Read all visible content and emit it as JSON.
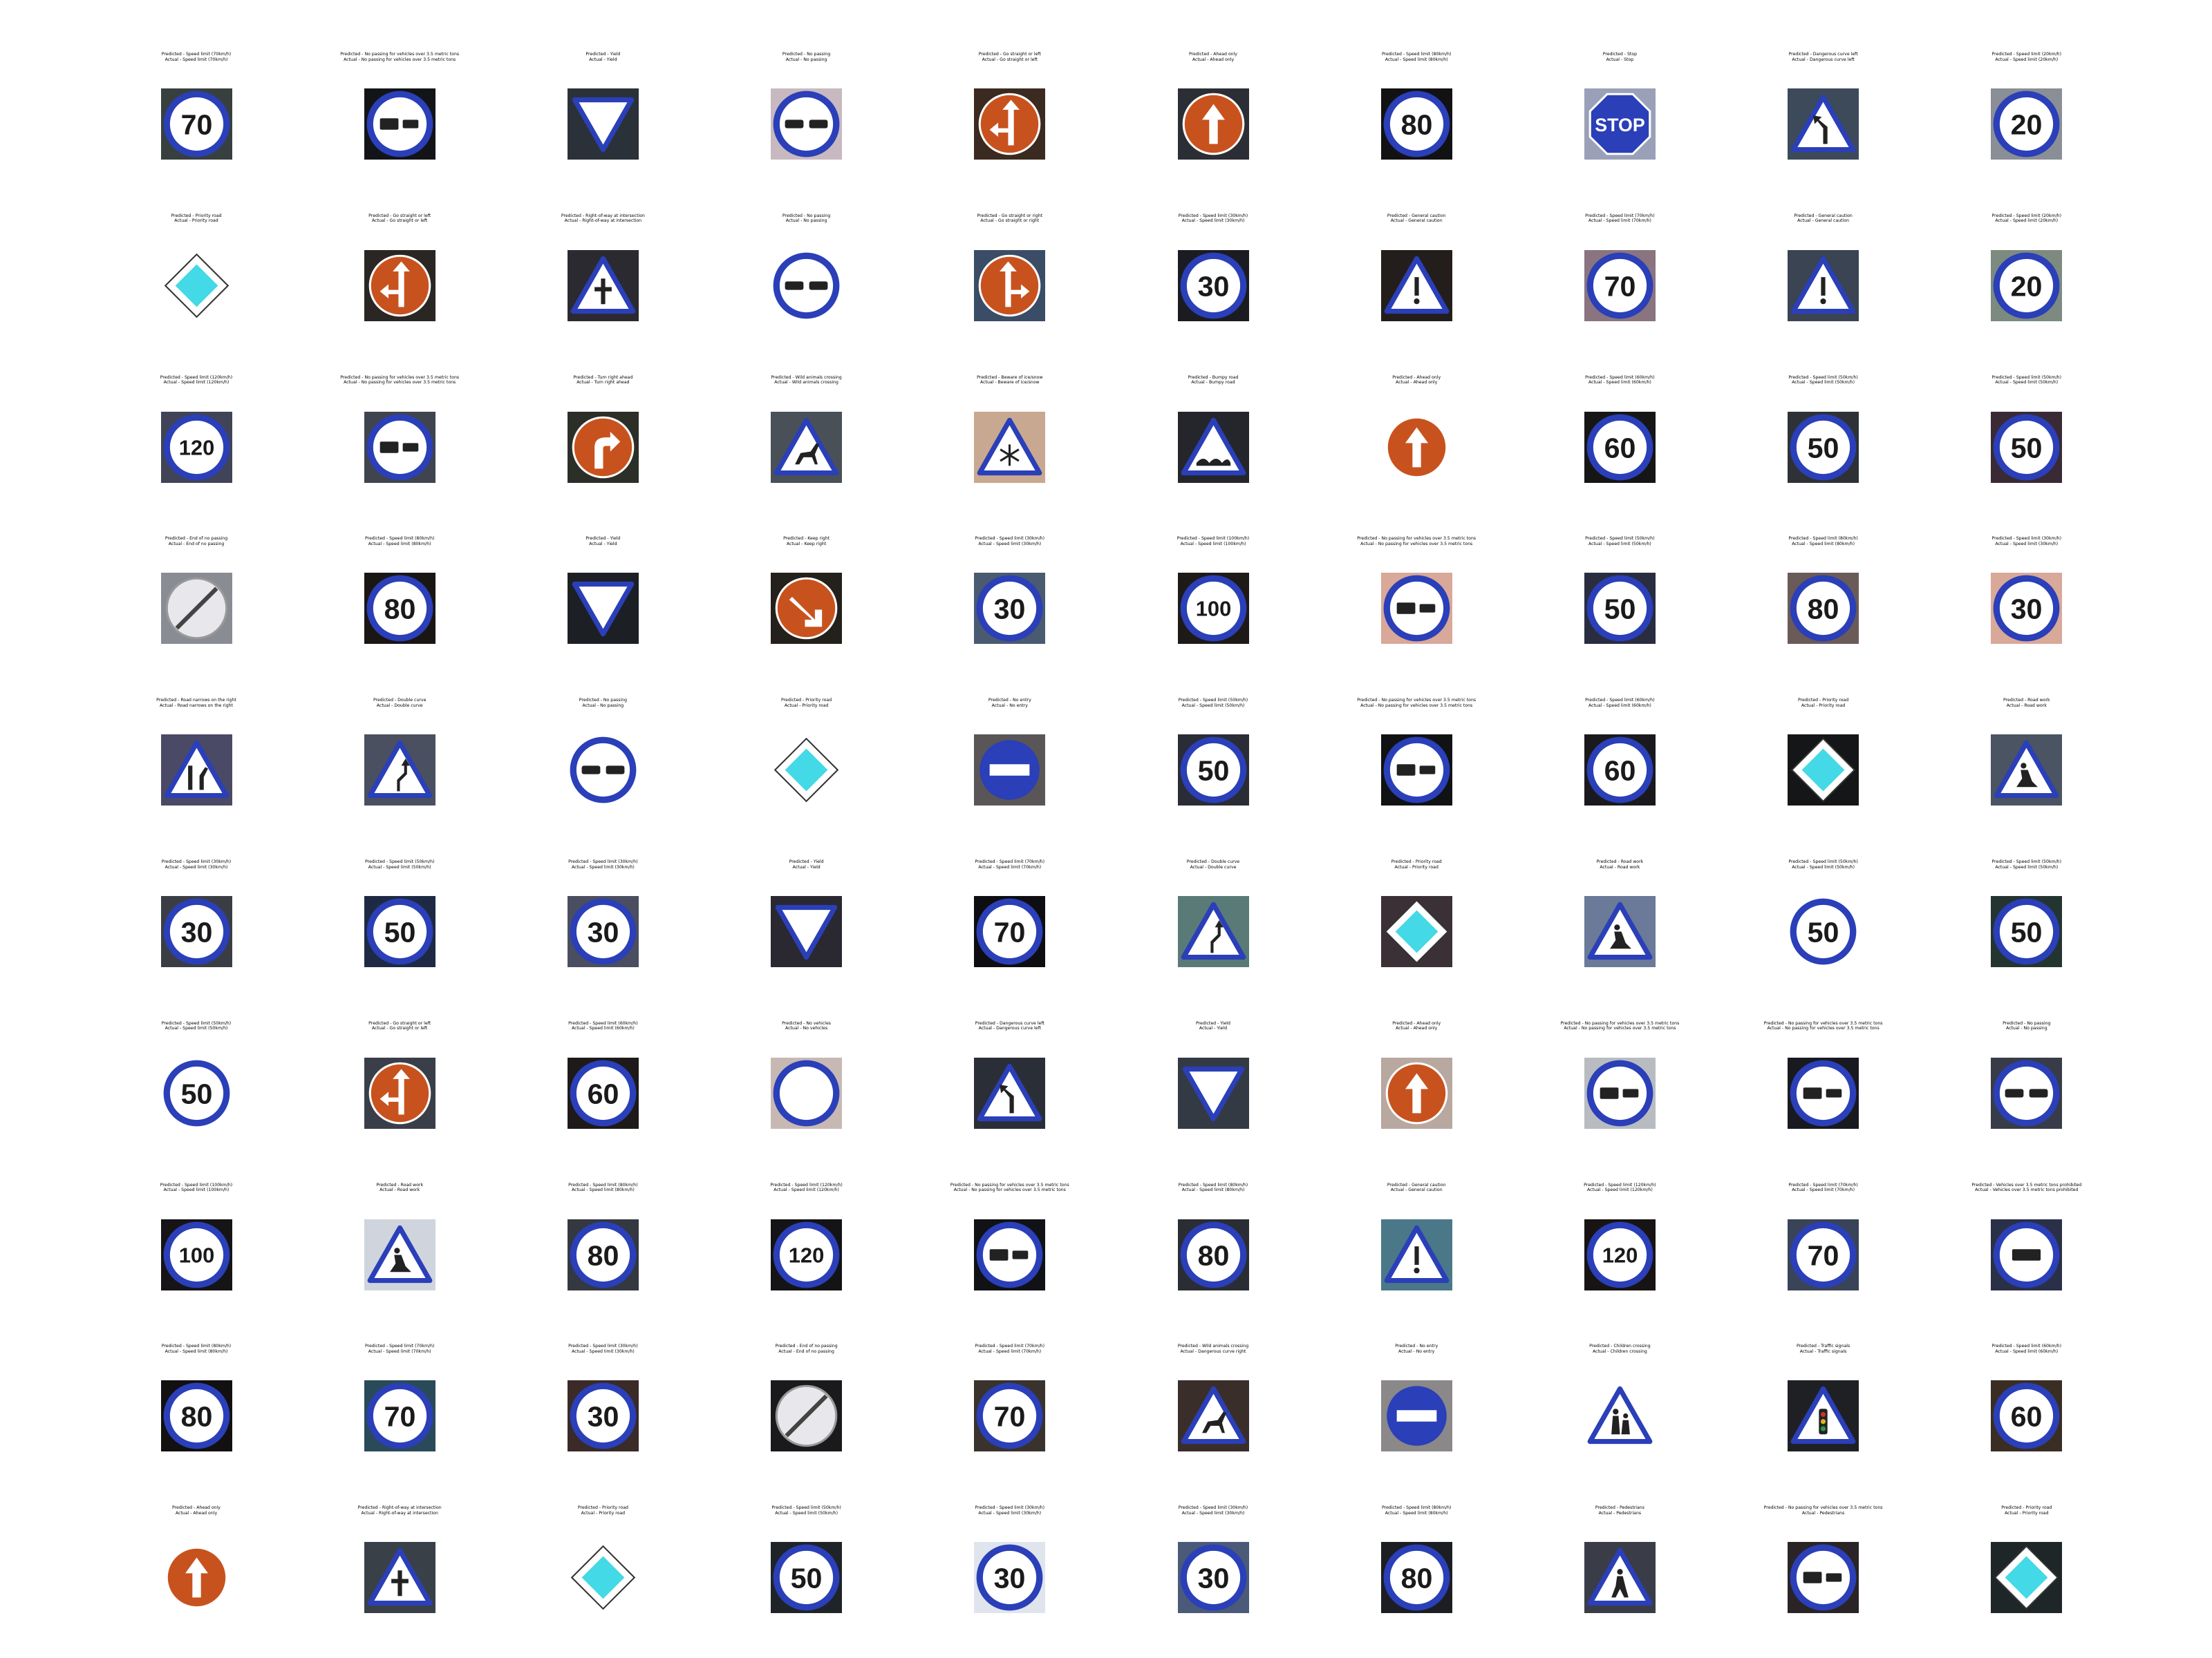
{
  "caption_prefixes": {
    "predicted": "Predicted - ",
    "actual": "Actual - "
  },
  "colors": {
    "blue": "#2a3fb8",
    "red": "#c0392b",
    "orange": "#c8521e",
    "white": "#ffffff",
    "yellow_diamond": "#44d9e6"
  },
  "grid": [
    [
      {
        "predicted": "Speed limit (70km/h)",
        "actual": "Speed limit (70km/h)",
        "icon": "speed-limit-sign",
        "text": "70",
        "bg": "#37403f"
      },
      {
        "predicted": "No passing for vehicles over 3.5 metric tons",
        "actual": "No passing for vehicles over 3.5 metric tons",
        "icon": "no-passing-trucks-sign",
        "text": "",
        "bg": "#131418"
      },
      {
        "predicted": "Yield",
        "actual": "Yield",
        "icon": "yield-sign",
        "text": "",
        "bg": "#2b3138"
      },
      {
        "predicted": "No passing",
        "actual": "No passing",
        "icon": "no-passing-sign",
        "text": "",
        "bg": "#c8b8c0"
      },
      {
        "predicted": "Go straight or left",
        "actual": "Go straight or left",
        "icon": "go-straight-or-left-sign",
        "text": "",
        "bg": "#3b2a20"
      },
      {
        "predicted": "Ahead only",
        "actual": "Ahead only",
        "icon": "ahead-only-sign",
        "text": "",
        "bg": "#2b2e34"
      },
      {
        "predicted": "Speed limit (80km/h)",
        "actual": "Speed limit (80km/h)",
        "icon": "speed-limit-sign",
        "text": "80",
        "bg": "#121214"
      },
      {
        "predicted": "Stop",
        "actual": "Stop",
        "icon": "stop-sign",
        "text": "STOP",
        "bg": "#9aa0b8"
      },
      {
        "predicted": "Dangerous curve left",
        "actual": "Dangerous curve left",
        "icon": "dangerous-curve-sign",
        "text": "",
        "bg": "#3c4a5a"
      },
      {
        "predicted": "Speed limit (20km/h)",
        "actual": "Speed limit (20km/h)",
        "icon": "speed-limit-sign",
        "text": "20",
        "bg": "#8a8e96"
      }
    ],
    [
      {
        "predicted": "Priority road",
        "actual": "Priority road",
        "icon": "priority-road-sign",
        "text": "",
        "bg": "#ffffff"
      },
      {
        "predicted": "Go straight or left",
        "actual": "Go straight or left",
        "icon": "go-straight-or-left-sign",
        "text": "",
        "bg": "#2a2624"
      },
      {
        "predicted": "Right-of-way at intersection",
        "actual": "Right-of-way at intersection",
        "icon": "right-of-way-sign",
        "text": "",
        "bg": "#2a2a30"
      },
      {
        "predicted": "No passing",
        "actual": "No passing",
        "icon": "no-passing-sign",
        "text": "",
        "bg": "#ffffff"
      },
      {
        "predicted": "Go straight or right",
        "actual": "Go straight or right",
        "icon": "go-straight-or-right-sign",
        "text": "",
        "bg": "#3a4c66"
      },
      {
        "predicted": "Speed limit (30km/h)",
        "actual": "Speed limit (30km/h)",
        "icon": "speed-limit-sign",
        "text": "30",
        "bg": "#1a1c22"
      },
      {
        "predicted": "General caution",
        "actual": "General caution",
        "icon": "general-caution-sign",
        "text": "",
        "bg": "#231e1c"
      },
      {
        "predicted": "Speed limit (70km/h)",
        "actual": "Speed limit (70km/h)",
        "icon": "speed-limit-sign",
        "text": "70",
        "bg": "#8a7480"
      },
      {
        "predicted": "General caution",
        "actual": "General caution",
        "icon": "general-caution-sign",
        "text": "",
        "bg": "#3a4452"
      },
      {
        "predicted": "Speed limit (20km/h)",
        "actual": "Speed limit (20km/h)",
        "icon": "speed-limit-sign",
        "text": "20",
        "bg": "#7c8a80"
      }
    ],
    [
      {
        "predicted": "Speed limit (120km/h)",
        "actual": "Speed limit (120km/h)",
        "icon": "speed-limit-sign",
        "text": "120",
        "bg": "#404456"
      },
      {
        "predicted": "No passing for vehicles over 3.5 metric tons",
        "actual": "No passing for vehicles over 3.5 metric tons",
        "icon": "no-passing-trucks-sign",
        "text": "",
        "bg": "#40444e"
      },
      {
        "predicted": "Turn right ahead",
        "actual": "Turn right ahead",
        "icon": "turn-right-ahead-sign",
        "text": "",
        "bg": "#2c2e28"
      },
      {
        "predicted": "Wild animals crossing",
        "actual": "Wild animals crossing",
        "icon": "wild-animals-sign",
        "text": "",
        "bg": "#4a5058"
      },
      {
        "predicted": "Beware of ice/snow",
        "actual": "Beware of ice/snow",
        "icon": "ice-snow-sign",
        "text": "",
        "bg": "#c8a890"
      },
      {
        "predicted": "Bumpy road",
        "actual": "Bumpy road",
        "icon": "bumpy-road-sign",
        "text": "",
        "bg": "#24262c"
      },
      {
        "predicted": "Ahead only",
        "actual": "Ahead only",
        "icon": "ahead-only-sign",
        "text": "",
        "bg": "#ffffff"
      },
      {
        "predicted": "Speed limit (60km/h)",
        "actual": "Speed limit (60km/h)",
        "icon": "speed-limit-sign",
        "text": "60",
        "bg": "#161616"
      },
      {
        "predicted": "Speed limit (50km/h)",
        "actual": "Speed limit (50km/h)",
        "icon": "speed-limit-sign",
        "text": "50",
        "bg": "#2e3236"
      },
      {
        "predicted": "Speed limit (50km/h)",
        "actual": "Speed limit (50km/h)",
        "icon": "speed-limit-sign",
        "text": "50",
        "bg": "#3a2a36"
      }
    ],
    [
      {
        "predicted": "End of no passing",
        "actual": "End of no passing",
        "icon": "end-of-no-passing-sign",
        "text": "",
        "bg": "#8a8c94"
      },
      {
        "predicted": "Speed limit (80km/h)",
        "actual": "Speed limit (80km/h)",
        "icon": "speed-limit-sign",
        "text": "80",
        "bg": "#1a1614"
      },
      {
        "predicted": "Yield",
        "actual": "Yield",
        "icon": "yield-sign",
        "text": "",
        "bg": "#1c2024"
      },
      {
        "predicted": "Keep right",
        "actual": "Keep right",
        "icon": "keep-right-sign",
        "text": "",
        "bg": "#24201c"
      },
      {
        "predicted": "Speed limit (30km/h)",
        "actual": "Speed limit (30km/h)",
        "icon": "speed-limit-sign",
        "text": "30",
        "bg": "#4a5a70"
      },
      {
        "predicted": "Speed limit (100km/h)",
        "actual": "Speed limit (100km/h)",
        "icon": "speed-limit-sign",
        "text": "100",
        "bg": "#1e1a18"
      },
      {
        "predicted": "No passing for vehicles over 3.5 metric tons",
        "actual": "No passing for vehicles over 3.5 metric tons",
        "icon": "no-passing-trucks-sign",
        "text": "",
        "bg": "#d8a898"
      },
      {
        "predicted": "Speed limit (50km/h)",
        "actual": "Speed limit (50km/h)",
        "icon": "speed-limit-sign",
        "text": "50",
        "bg": "#2a2c40"
      },
      {
        "predicted": "Speed limit (80km/h)",
        "actual": "Speed limit (80km/h)",
        "icon": "speed-limit-sign",
        "text": "80",
        "bg": "#6a5a58"
      },
      {
        "predicted": "Speed limit (30km/h)",
        "actual": "Speed limit (30km/h)",
        "icon": "speed-limit-sign",
        "text": "30",
        "bg": "#d8a898"
      }
    ],
    [
      {
        "predicted": "Road narrows on the right",
        "actual": "Road narrows on the right",
        "icon": "road-narrows-sign",
        "text": "",
        "bg": "#4a4a66"
      },
      {
        "predicted": "Double curve",
        "actual": "Double curve",
        "icon": "double-curve-sign",
        "text": "",
        "bg": "#4a5060"
      },
      {
        "predicted": "No passing",
        "actual": "No passing",
        "icon": "no-passing-sign",
        "text": "",
        "bg": "#ffffff"
      },
      {
        "predicted": "Priority road",
        "actual": "Priority road",
        "icon": "priority-road-sign",
        "text": "",
        "bg": "#ffffff"
      },
      {
        "predicted": "No entry",
        "actual": "No entry",
        "icon": "no-entry-sign",
        "text": "",
        "bg": "#5a5658"
      },
      {
        "predicted": "Speed limit (50km/h)",
        "actual": "Speed limit (50km/h)",
        "icon": "speed-limit-sign",
        "text": "50",
        "bg": "#2a2c36"
      },
      {
        "predicted": "No passing for vehicles over 3.5 metric tons",
        "actual": "No passing for vehicles over 3.5 metric tons",
        "icon": "no-passing-trucks-sign",
        "text": "",
        "bg": "#111214"
      },
      {
        "predicted": "Speed limit (60km/h)",
        "actual": "Speed limit (60km/h)",
        "icon": "speed-limit-sign",
        "text": "60",
        "bg": "#1a1a1e"
      },
      {
        "predicted": "Priority road",
        "actual": "Priority road",
        "icon": "priority-road-sign",
        "text": "",
        "bg": "#141618"
      },
      {
        "predicted": "Road work",
        "actual": "Road work",
        "icon": "road-work-sign",
        "text": "",
        "bg": "#4a5462"
      }
    ],
    [
      {
        "predicted": "Speed limit (30km/h)",
        "actual": "Speed limit (30km/h)",
        "icon": "speed-limit-sign",
        "text": "30",
        "bg": "#3a3e44"
      },
      {
        "predicted": "Speed limit (50km/h)",
        "actual": "Speed limit (50km/h)",
        "icon": "speed-limit-sign",
        "text": "50",
        "bg": "#1e2a44"
      },
      {
        "predicted": "Speed limit (30km/h)",
        "actual": "Speed limit (30km/h)",
        "icon": "speed-limit-sign",
        "text": "30",
        "bg": "#4a4e60"
      },
      {
        "predicted": "Yield",
        "actual": "Yield",
        "icon": "yield-sign",
        "text": "",
        "bg": "#2a2830"
      },
      {
        "predicted": "Speed limit (70km/h)",
        "actual": "Speed limit (70km/h)",
        "icon": "speed-limit-sign",
        "text": "70",
        "bg": "#0e0e12"
      },
      {
        "predicted": "Double curve",
        "actual": "Double curve",
        "icon": "double-curve-sign",
        "text": "",
        "bg": "#5a7a78"
      },
      {
        "predicted": "Priority road",
        "actual": "Priority road",
        "icon": "priority-road-sign",
        "text": "",
        "bg": "#3a3036"
      },
      {
        "predicted": "Road work",
        "actual": "Road work",
        "icon": "road-work-sign",
        "text": "",
        "bg": "#6a7a98"
      },
      {
        "predicted": "Speed limit (50km/h)",
        "actual": "Speed limit (50km/h)",
        "icon": "speed-limit-sign",
        "text": "50",
        "bg": "#ffffff"
      },
      {
        "predicted": "Speed limit (50km/h)",
        "actual": "Speed limit (50km/h)",
        "icon": "speed-limit-sign",
        "text": "50",
        "bg": "#243430"
      }
    ],
    [
      {
        "predicted": "Speed limit (50km/h)",
        "actual": "Speed limit (50km/h)",
        "icon": "speed-limit-sign",
        "text": "50",
        "bg": "#ffffff"
      },
      {
        "predicted": "Go straight or left",
        "actual": "Go straight or left",
        "icon": "go-straight-or-left-sign",
        "text": "",
        "bg": "#3a3e48"
      },
      {
        "predicted": "Speed limit (60km/h)",
        "actual": "Speed limit (60km/h)",
        "icon": "speed-limit-sign",
        "text": "60",
        "bg": "#1e1a1a"
      },
      {
        "predicted": "No vehicles",
        "actual": "No vehicles",
        "icon": "no-vehicles-sign",
        "text": "",
        "bg": "#c8b8b4"
      },
      {
        "predicted": "Dangerous curve left",
        "actual": "Dangerous curve left",
        "icon": "dangerous-curve-sign",
        "text": "",
        "bg": "#2a2e36"
      },
      {
        "predicted": "Yield",
        "actual": "Yield",
        "icon": "yield-sign",
        "text": "",
        "bg": "#343a44"
      },
      {
        "predicted": "Ahead only",
        "actual": "Ahead only",
        "icon": "ahead-only-sign",
        "text": "",
        "bg": "#b8a8a0"
      },
      {
        "predicted": "No passing for vehicles over 3.5 metric tons",
        "actual": "No passing for vehicles over 3.5 metric tons",
        "icon": "no-passing-trucks-sign",
        "text": "",
        "bg": "#b8bcc0"
      },
      {
        "predicted": "No passing for vehicles over 3.5 metric tons",
        "actual": "No passing for vehicles over 3.5 metric tons",
        "icon": "no-passing-trucks-sign",
        "text": "",
        "bg": "#181a20"
      },
      {
        "predicted": "No passing",
        "actual": "No passing",
        "icon": "no-passing-sign",
        "text": "",
        "bg": "#383c48"
      }
    ],
    [
      {
        "predicted": "Speed limit (100km/h)",
        "actual": "Speed limit (100km/h)",
        "icon": "speed-limit-sign",
        "text": "100",
        "bg": "#161416"
      },
      {
        "predicted": "Road work",
        "actual": "Road work",
        "icon": "road-work-sign",
        "text": "",
        "bg": "#d0d4dc"
      },
      {
        "predicted": "Speed limit (80km/h)",
        "actual": "Speed limit (80km/h)",
        "icon": "speed-limit-sign",
        "text": "80",
        "bg": "#343840"
      },
      {
        "predicted": "Speed limit (120km/h)",
        "actual": "Speed limit (120km/h)",
        "icon": "speed-limit-sign",
        "text": "120",
        "bg": "#141416"
      },
      {
        "predicted": "No passing for vehicles over 3.5 metric tons",
        "actual": "No passing for vehicles over 3.5 metric tons",
        "icon": "no-passing-trucks-sign",
        "text": "",
        "bg": "#101216"
      },
      {
        "predicted": "Speed limit (80km/h)",
        "actual": "Speed limit (80km/h)",
        "icon": "speed-limit-sign",
        "text": "80",
        "bg": "#2a2e34"
      },
      {
        "predicted": "General caution",
        "actual": "General caution",
        "icon": "general-caution-sign",
        "text": "",
        "bg": "#4a7888"
      },
      {
        "predicted": "Speed limit (120km/h)",
        "actual": "Speed limit (120km/h)",
        "icon": "speed-limit-sign",
        "text": "120",
        "bg": "#181414"
      },
      {
        "predicted": "Speed limit (70km/h)",
        "actual": "Speed limit (70km/h)",
        "icon": "speed-limit-sign",
        "text": "70",
        "bg": "#3a4458"
      },
      {
        "predicted": "Vehicles over 3.5 metric tons prohibited",
        "actual": "Vehicles over 3.5 metric tons prohibited",
        "icon": "trucks-prohibited-sign",
        "text": "",
        "bg": "#2a3048"
      }
    ],
    [
      {
        "predicted": "Speed limit (80km/h)",
        "actual": "Speed limit (80km/h)",
        "icon": "speed-limit-sign",
        "text": "80",
        "bg": "#121010"
      },
      {
        "predicted": "Speed limit (70km/h)",
        "actual": "Speed limit (70km/h)",
        "icon": "speed-limit-sign",
        "text": "70",
        "bg": "#2a4a5a"
      },
      {
        "predicted": "Speed limit (30km/h)",
        "actual": "Speed limit (30km/h)",
        "icon": "speed-limit-sign",
        "text": "30",
        "bg": "#3a2a28"
      },
      {
        "predicted": "End of no passing",
        "actual": "End of no passing",
        "icon": "end-of-no-passing-sign",
        "text": "",
        "bg": "#1a1a1c"
      },
      {
        "predicted": "Speed limit (70km/h)",
        "actual": "Speed limit (70km/h)",
        "icon": "speed-limit-sign",
        "text": "70",
        "bg": "#3a322c"
      },
      {
        "predicted": "Wild animals crossing",
        "actual": "Dangerous curve right",
        "icon": "wild-animals-sign",
        "text": "",
        "bg": "#3a2e2a"
      },
      {
        "predicted": "No entry",
        "actual": "No entry",
        "icon": "no-entry-sign",
        "text": "",
        "bg": "#8a8888"
      },
      {
        "predicted": "Children crossing",
        "actual": "Children crossing",
        "icon": "children-crossing-sign",
        "text": "",
        "bg": "#ffffff"
      },
      {
        "predicted": "Traffic signals",
        "actual": "Traffic signals",
        "icon": "traffic-signals-sign",
        "text": "",
        "bg": "#1e2024"
      },
      {
        "predicted": "Speed limit (60km/h)",
        "actual": "Speed limit (60km/h)",
        "icon": "speed-limit-sign",
        "text": "60",
        "bg": "#3a2e24"
      }
    ],
    [
      {
        "predicted": "Ahead only",
        "actual": "Ahead only",
        "icon": "ahead-only-sign",
        "text": "",
        "bg": "#ffffff"
      },
      {
        "predicted": "Right-of-way at intersection",
        "actual": "Right-of-way at intersection",
        "icon": "right-of-way-sign",
        "text": "",
        "bg": "#3a4048"
      },
      {
        "predicted": "Priority road",
        "actual": "Priority road",
        "icon": "priority-road-sign",
        "text": "",
        "bg": "#ffffff"
      },
      {
        "predicted": "Speed limit (50km/h)",
        "actual": "Speed limit (50km/h)",
        "icon": "speed-limit-sign",
        "text": "50",
        "bg": "#1e2428"
      },
      {
        "predicted": "Speed limit (30km/h)",
        "actual": "Speed limit (30km/h)",
        "icon": "speed-limit-sign",
        "text": "30",
        "bg": "#e0e4ec"
      },
      {
        "predicted": "Speed limit (30km/h)",
        "actual": "Speed limit (30km/h)",
        "icon": "speed-limit-sign",
        "text": "30",
        "bg": "#4a5a78"
      },
      {
        "predicted": "Speed limit (80km/h)",
        "actual": "Speed limit (80km/h)",
        "icon": "speed-limit-sign",
        "text": "80",
        "bg": "#1c1e24"
      },
      {
        "predicted": "Pedestrians",
        "actual": "Pedestrians",
        "icon": "pedestrians-sign",
        "text": "",
        "bg": "#3a3c48"
      },
      {
        "predicted": "No passing for vehicles over 3.5 metric tons",
        "actual": "Pedestrians",
        "icon": "no-passing-trucks-sign",
        "text": "",
        "bg": "#2a2426"
      },
      {
        "predicted": "Priority road",
        "actual": "Priority road",
        "icon": "priority-road-sign",
        "text": "",
        "bg": "#1e2628"
      }
    ]
  ]
}
